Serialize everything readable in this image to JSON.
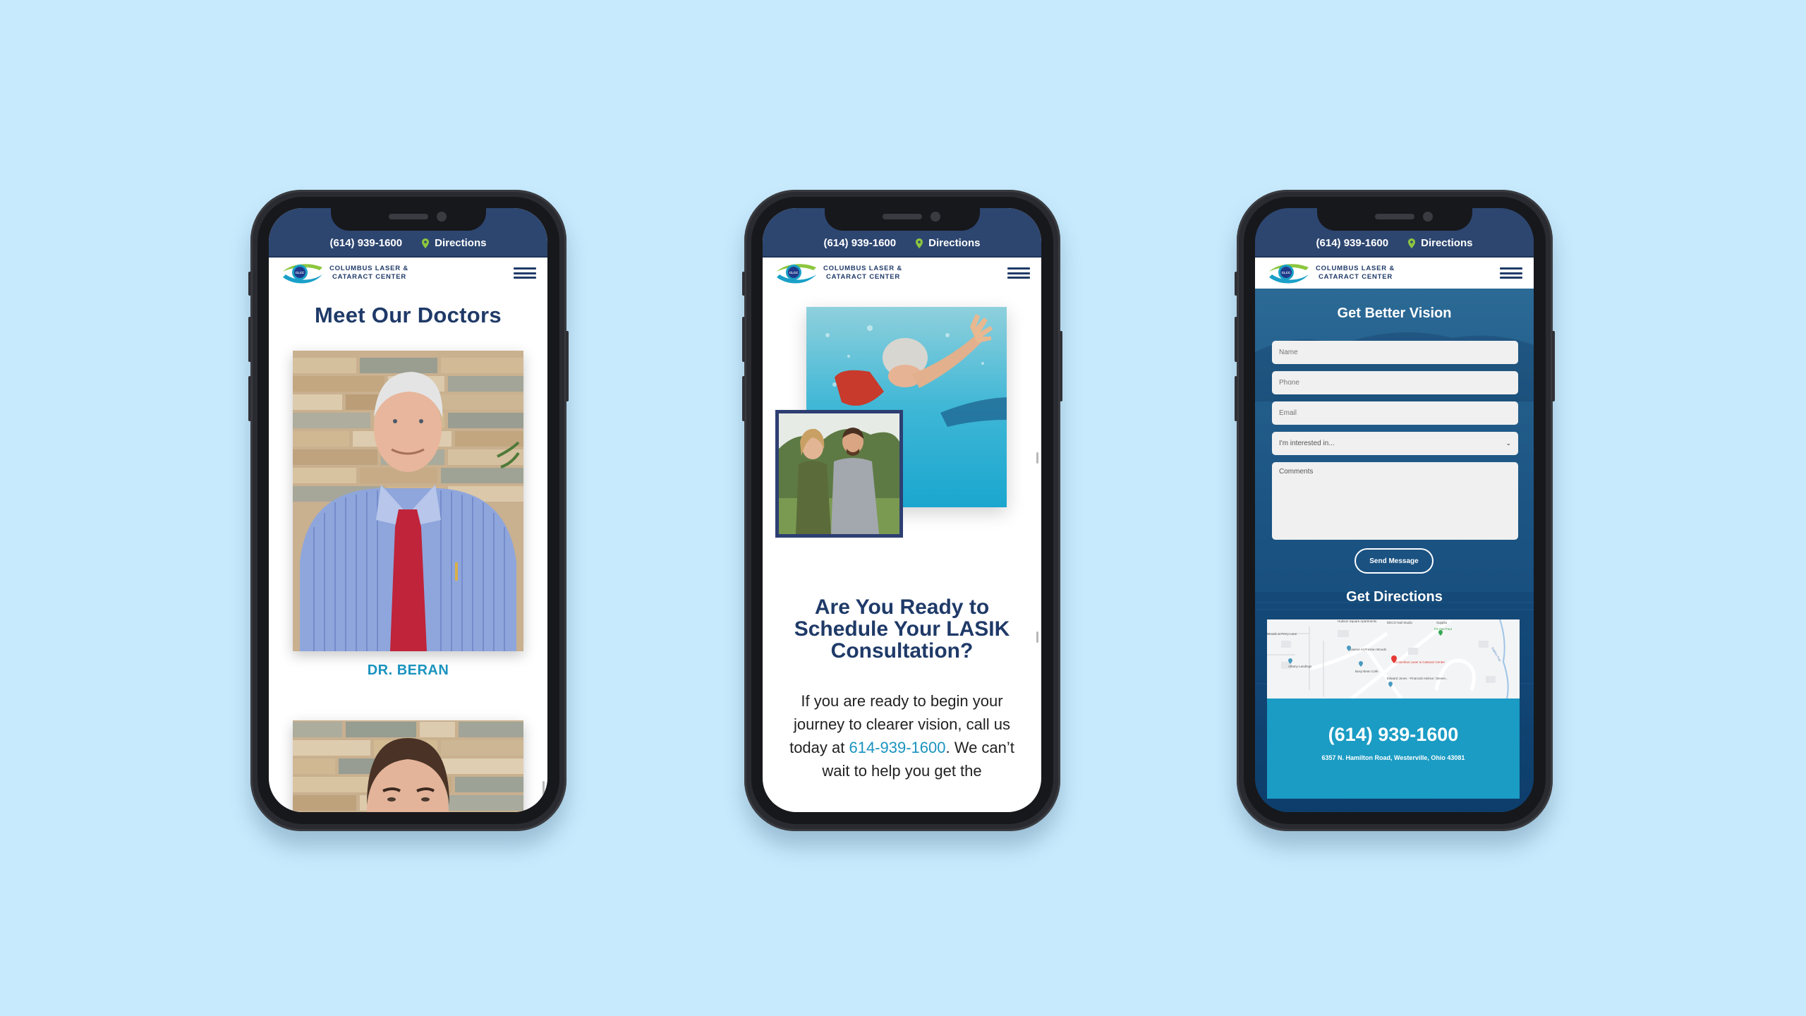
{
  "colors": {
    "background": "#c8eafd",
    "topbar": "#2d4670",
    "navy": "#1f3a68",
    "accent_teal": "#1a93bf",
    "pin_green": "#8cc63f",
    "contact_box": "#1a9cc4"
  },
  "site": {
    "phone": "(614) 939-1600",
    "directions_label": "Directions",
    "logo_line1": "COLUMBUS LASER &",
    "logo_line2": "CATARACT CENTER",
    "logo_badge": "CLCC"
  },
  "phones": [
    {
      "page": "doctors",
      "title": "Meet Our Doctors",
      "doctors": [
        {
          "name": "DR. BERAN"
        },
        {
          "name": ""
        }
      ]
    },
    {
      "page": "lasik-cta",
      "images": [
        "swimmer",
        "couple-walking"
      ],
      "cta_title": "Are You Ready to Schedule Your LASIK Consultation?",
      "body_before": "If you are ready to begin your journey to clearer vision, call us today at ",
      "body_link": "614-939-1600",
      "body_after": ". We can’t wait to help you get the"
    },
    {
      "page": "contact",
      "form_title": "Get Better Vision",
      "fields": {
        "name_placeholder": "Name",
        "phone_placeholder": "Phone",
        "email_placeholder": "Email",
        "interest_placeholder": "I'm interested in...",
        "comments_placeholder": "Comments"
      },
      "send_label": "Send Message",
      "directions_title": "Get Directions",
      "map_labels": {
        "apartments": "Hudson Square Apartments",
        "nail": "DECO Nail Studio",
        "supplier": "Supplia",
        "fit": "Fit One Four",
        "woods": "Woods at Perry Lane",
        "reserve": "Reserve At Preston Woods",
        "albany": "Albany Landings",
        "cafe": "Busy Bean Cafe",
        "clinic": "Columbus Laser & Cataract Center",
        "edward": "Edward Jones - Financial Advisor: Steven...",
        "creek": "Sulphur Fork"
      },
      "contact_phone": "(614) 939-1600",
      "address": "6357 N. Hamilton Road, Westerville, Ohio 43081"
    }
  ]
}
